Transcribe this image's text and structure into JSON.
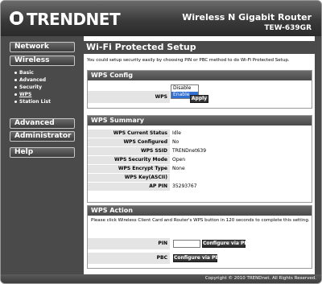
{
  "header": {
    "logo_text": "TRENDNET",
    "product_name": "Wireless N Gigabit Router",
    "model": "TEW-639GR"
  },
  "sidebar": {
    "network": "Network",
    "wireless": "Wireless",
    "wireless_items": [
      "Basic",
      "Advanced",
      "Security",
      "WPS",
      "Station List"
    ],
    "advanced": "Advanced",
    "administrator": "Administrator",
    "help": "Help"
  },
  "main": {
    "title": "Wi-Fi Protected Setup",
    "intro": "You could setup security easily by choosing PIN or PBC method to do Wi-Fi Protected Setup."
  },
  "wps_config": {
    "heading": "WPS Config",
    "wps_label": "WPS",
    "options": [
      "Disable",
      "Enable"
    ],
    "selected": "Enable",
    "apply_label": "Apply"
  },
  "wps_summary": {
    "heading": "WPS Summary",
    "rows": [
      {
        "label": "WPS Current Status",
        "value": "Idle"
      },
      {
        "label": "WPS Configured",
        "value": "No"
      },
      {
        "label": "WPS SSID",
        "value": "TRENDnet639"
      },
      {
        "label": "WPS Security Mode",
        "value": "Open"
      },
      {
        "label": "WPS Encrypt Type",
        "value": "None"
      },
      {
        "label": "WPS Key(ASCII)",
        "value": ""
      },
      {
        "label": "AP PIN",
        "value": "35293767"
      }
    ]
  },
  "wps_action": {
    "heading": "WPS Action",
    "description": "Please click Wireless Client Card and Router's WPS button in 120 seconds to complete this setting.",
    "pin_label": "PIN",
    "pin_value": "",
    "pin_button": "Configure via PIN",
    "pbc_label": "PBC",
    "pbc_button": "Configure via PBC"
  },
  "footer": {
    "copyright": "Copyright © 2010 TRENDnet. All Rights Reserved."
  }
}
